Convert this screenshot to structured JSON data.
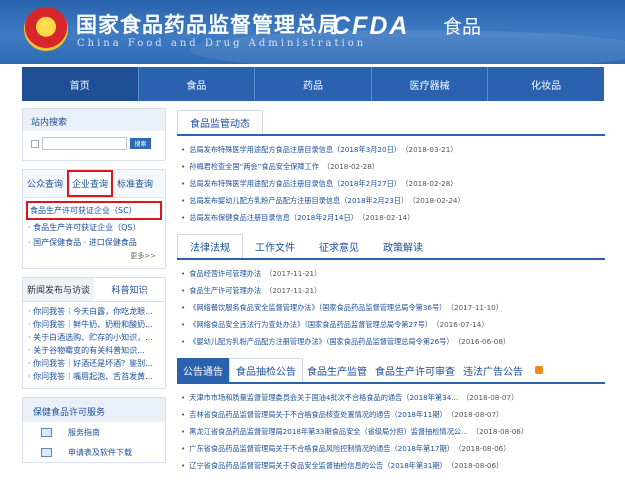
{
  "header": {
    "title": "国家食品药品监督管理总局",
    "subtitle": "China Food and Drug Administration",
    "logo_text": "CFDA",
    "section": "食品"
  },
  "nav": [
    "首页",
    "食品",
    "药品",
    "医疗器械",
    "化妆品"
  ],
  "site_search": {
    "title": "站内搜索",
    "button": "搜索"
  },
  "query": {
    "tabs": [
      "公众查询",
      "企业查询",
      "标准查询"
    ],
    "items": [
      "食品生产许可获证企业（SC）",
      "食品生产许可获证企业（QS）",
      "国产保健食品",
      "进口保健食品"
    ],
    "more": "更多>>"
  },
  "news": {
    "tabs": [
      "新闻发布与访谈",
      "科普知识"
    ],
    "items": [
      "你问我答｜今天白露，你吃龙眼...",
      "你问我答｜鲜牛奶、奶粉和酸奶...",
      "关于白酒选购、贮存的小知识，...",
      "关于谷物霉变的有关科普知识...",
      "你问我答｜好酒还是坏酒？鉴别...",
      "你问我答｜嘴唇起泡、舌苔发黄..."
    ]
  },
  "service": {
    "title": "保健食品许可服务",
    "items": [
      "服务指南",
      "申请表及软件下载"
    ]
  },
  "section1": {
    "tab": "食品监管动态",
    "items": [
      {
        "text": "总局发布特殊医学用途配方食品注册目录信息（2018年3月20日）",
        "date": "（2018-03-21）"
      },
      {
        "text": "孙梅君检查全国“两会”食品安全保障工作",
        "date": "（2018-02-28）"
      },
      {
        "text": "总局发布特殊医学用途配方食品注册目录信息（2018年2月27日）",
        "date": "（2018-02-28）"
      },
      {
        "text": "总局发布婴幼儿配方乳粉产品配方注册目录信息（2018年2月23日）",
        "date": "（2018-02-24）"
      },
      {
        "text": "总局发布保健食品注册目录信息（2018年2月14日）",
        "date": "（2018-02-14）"
      }
    ]
  },
  "section2": {
    "tabs": [
      "法律法规",
      "工作文件",
      "征求意见",
      "政策解读"
    ],
    "items": [
      {
        "text": "食品经营许可管理办法",
        "date": "（2017-11-21）"
      },
      {
        "text": "食品生产许可管理办法",
        "date": "（2017-11-21）"
      },
      {
        "text": "《网络餐饮服务食品安全监督管理办法》（国家食品药品监督管理总局令第36号）",
        "date": "（2017-11-10）"
      },
      {
        "text": "《网络食品安全违法行为查处办法》（国家食品药品监督管理总局令第27号）",
        "date": "（2016-07-14）"
      },
      {
        "text": "《婴幼儿配方乳粉产品配方注册管理办法》（国家食品药品监督管理总局令第26号）",
        "date": "（2016-06-08）"
      }
    ]
  },
  "section3": {
    "tabs": [
      "公告通告",
      "食品抽检公告",
      "食品生产监管",
      "食品生产许可审查",
      "违法广告公告"
    ],
    "items": [
      {
        "text": "天津市市场和质量监督管理委员会关于国油4批次不合格食品的通告（2018年第34...",
        "date": "（2018-08-07）"
      },
      {
        "text": "吉林省食品药品监督管理局关于不合格食品核查处置情况的通告（2018年11期）",
        "date": "（2018-08-07）"
      },
      {
        "text": "黑龙江省食品药品监督管理局2018年第33期食品安全（省级局分担）监督抽检情况公...",
        "date": "（2018-08-06）"
      },
      {
        "text": "广东省食品药品监督管理局关于不合格食品风险控制情况的通告（2018年第17期）",
        "date": "（2018-08-06）"
      },
      {
        "text": "辽宁省食品药品监督管理局关于食品安全监督抽检信息的公告（2018年第31期）",
        "date": "（2018-08-06）"
      }
    ]
  },
  "colors": {
    "header_blue": "#2a63ad",
    "nav_blue": "#2a62b0",
    "link_blue": "#1c4f97",
    "highlight_red": "#e0141b"
  }
}
